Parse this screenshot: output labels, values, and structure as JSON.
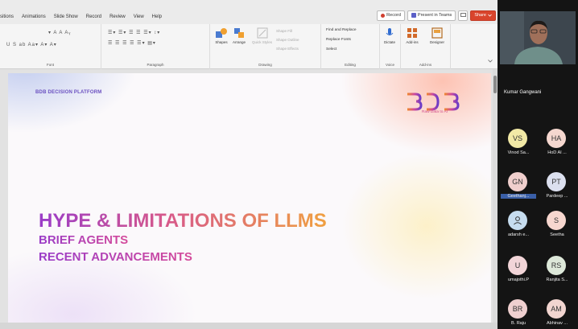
{
  "menu": {
    "tabs": [
      "sitions",
      "Animations",
      "Slide Show",
      "Record",
      "Review",
      "View",
      "Help"
    ],
    "record": "Record",
    "present_in_teams": "Present in Teams",
    "share": "Share"
  },
  "ribbon": {
    "groups": {
      "font": "Font",
      "paragraph": "Paragraph",
      "drawing": "Drawing",
      "editing": "Editing",
      "voice": "Voice",
      "addins": "Add-ins"
    },
    "shapes": "Shapes",
    "arrange": "Arrange",
    "quick_styles": "Quick Styles",
    "shape_fill": "Shape Fill",
    "shape_outline": "Shape Outline",
    "shape_effects": "Shape Effects",
    "find_replace": "Find and Replace",
    "replace_fonts": "Replace Fonts",
    "select": "Select",
    "dictate": "Dictate",
    "addins": "Add-ins",
    "designer": "Designer"
  },
  "slide": {
    "platform": "BDB DECISION PLATFORM",
    "logo_tagline": "Raw Data to AI",
    "title": "HYPE & LIMITATIONS OF LLMS",
    "line2": "BRIEF AGENTS",
    "line3": "RECENT ADVANCEMENTS"
  },
  "panel": {
    "presenter": "Kumar Gangwani",
    "participants": [
      {
        "initials": "VS",
        "name": "Vinod Sa...",
        "color": "#f2e9a6"
      },
      {
        "initials": "HA",
        "name": "HoD AI ...",
        "color": "#f5d7cf"
      },
      {
        "initials": "GN",
        "name": "Geethanj...",
        "color": "#f0cfcd"
      },
      {
        "initials": "PT",
        "name": "Pardeep ...",
        "color": "#dce0ef"
      },
      {
        "initials": "",
        "name": "adarsh e...",
        "color": "#c6dcef"
      },
      {
        "initials": "S",
        "name": "Seetha",
        "color": "#f7d7cf"
      },
      {
        "initials": "U",
        "name": "umajothi.P",
        "color": "#f2d5d8"
      },
      {
        "initials": "RS",
        "name": "Ranjita S...",
        "color": "#dde8d9"
      },
      {
        "initials": "BR",
        "name": "B. Raju",
        "color": "#efcfcf"
      },
      {
        "initials": "AM",
        "name": "Abhinav ...",
        "color": "#f2d5d0"
      }
    ]
  }
}
